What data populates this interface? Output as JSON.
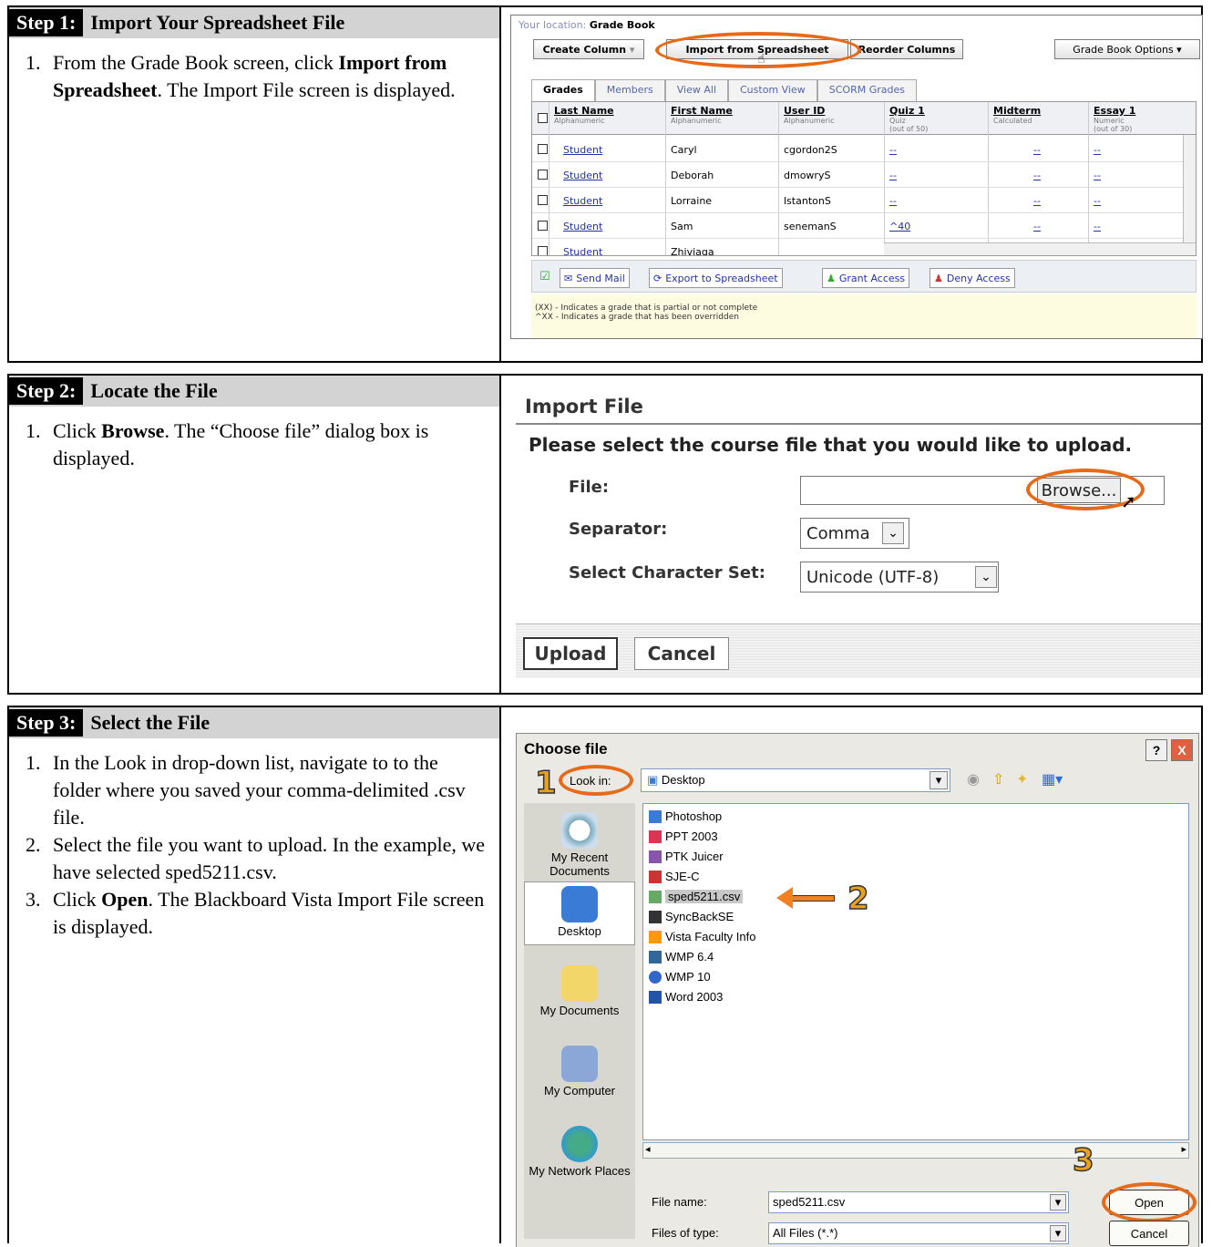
{
  "step1": {
    "label": "Step 1:",
    "title": "Import Your Spreadsheet File",
    "items": [
      {
        "num": "1.",
        "pre": "From the Grade Book screen, click ",
        "bold": "Import from Spreadsheet",
        "post": ". The Import File screen is displayed."
      }
    ],
    "gradebook": {
      "location_label": "Your location:",
      "location_value": "Grade Book",
      "buttons": {
        "create": "Create Column",
        "import": "Import from Spreadsheet",
        "reorder": "Reorder Columns",
        "options": "Grade Book Options"
      },
      "tabs": [
        "Grades",
        "Members",
        "View All",
        "Custom View",
        "SCORM Grades"
      ],
      "columns": [
        {
          "title": "Last Name",
          "sub": "Alphanumeric"
        },
        {
          "title": "First Name",
          "sub": "Alphanumeric"
        },
        {
          "title": "User ID",
          "sub": "Alphanumeric"
        },
        {
          "title": "Quiz 1",
          "sub": "Quiz",
          "sub2": "(out of 50)"
        },
        {
          "title": "Midterm",
          "sub": "Calculated"
        },
        {
          "title": "Essay 1",
          "sub": "Numeric",
          "sub2": "(out of 30)"
        }
      ],
      "rows": [
        {
          "last": "Student",
          "first": "Caryl",
          "uid": "cgordon2S",
          "quiz": "--",
          "mid": "--",
          "essay": "--"
        },
        {
          "last": "Student",
          "first": "Deborah",
          "uid": "dmowryS",
          "quiz": "--",
          "mid": "--",
          "essay": "--"
        },
        {
          "last": "Student",
          "first": "Lorraine",
          "uid": "lstantonS",
          "quiz": "--",
          "mid": "--",
          "essay": "--"
        },
        {
          "last": "Student",
          "first": "Sam",
          "uid": "senemanS",
          "quiz": "^40",
          "mid": "--",
          "essay": "--"
        },
        {
          "last": "Student",
          "first": "Zhiviaga",
          "uid": "",
          "quiz": "",
          "mid": "",
          "essay": ""
        }
      ],
      "footer_buttons": {
        "mail": "Send Mail",
        "export": "Export to Spreadsheet",
        "grant": "Grant Access",
        "deny": "Deny Access"
      },
      "notes": [
        "(XX) - Indicates a grade that is partial or not complete",
        "^XX - Indicates a grade that has been overridden"
      ]
    }
  },
  "step2": {
    "label": "Step 2:",
    "title": "Locate the File",
    "items": [
      {
        "num": "1.",
        "pre": "Click ",
        "bold": "Browse",
        "post": ". The “Choose file” dialog box is displayed."
      }
    ],
    "import_file": {
      "title": "Import File",
      "prompt": "Please select the course file that you would like to upload.",
      "file_label": "File:",
      "file_value": "",
      "browse": "Browse...",
      "separator_label": "Separator:",
      "separator_value": "Comma",
      "charset_label": "Select Character Set:",
      "charset_value": "Unicode (UTF-8)",
      "upload": "Upload",
      "cancel": "Cancel"
    }
  },
  "step3": {
    "label": "Step 3:",
    "title": "Select the File",
    "items": [
      {
        "num": "1.",
        "pre": "In the Look in drop-down list, navigate to to the folder where you saved your comma-delimited .csv file.",
        "bold": "",
        "post": ""
      },
      {
        "num": "2.",
        "pre": "Select the file you want to upload. In the example, we have selected sped5211.csv.",
        "bold": "",
        "post": ""
      },
      {
        "num": "3.",
        "pre": "Click ",
        "bold": "Open",
        "post": ". The Blackboard Vista Import File screen is displayed."
      }
    ],
    "dialog": {
      "title": "Choose file",
      "help": "?",
      "close": "X",
      "look_in_label": "Look in:",
      "look_in_value": "Desktop",
      "places": [
        "My Recent Documents",
        "Desktop",
        "My Documents",
        "My Computer",
        "My Network Places"
      ],
      "files": [
        "Photoshop",
        "PPT 2003",
        "PTK Juicer",
        "SJE-C",
        "sped5211.csv",
        "SyncBackSE",
        "Vista Faculty Info",
        "WMP 6.4",
        "WMP 10",
        "Word 2003"
      ],
      "selected_file": "sped5211.csv",
      "file_name_label": "File name:",
      "file_name_value": "sped5211.csv",
      "files_of_type_label": "Files of type:",
      "files_of_type_value": "All Files (*.*)",
      "open": "Open",
      "cancel": "Cancel",
      "callouts": [
        "1",
        "2",
        "3"
      ]
    }
  },
  "colors": {
    "highlight": "#e66a1a",
    "callout": "#e8a21c",
    "header_bg": "#d3d3d3"
  }
}
